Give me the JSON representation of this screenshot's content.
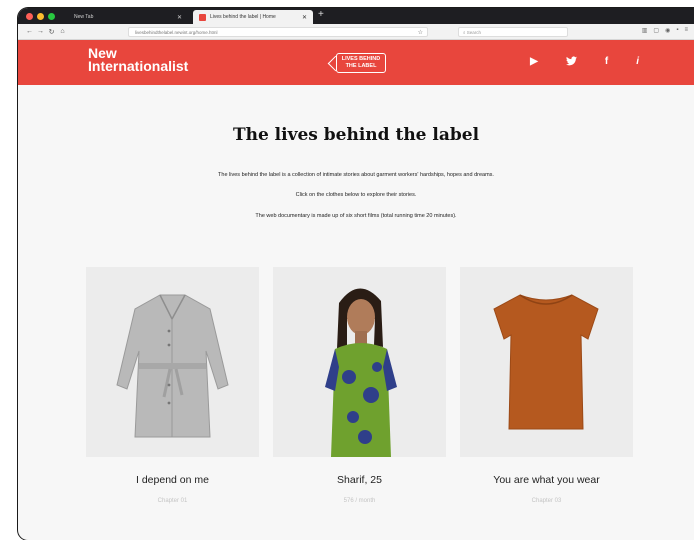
{
  "browser": {
    "tabs": [
      {
        "label": "New Tab"
      },
      {
        "label": "Lives behind the label | Home"
      }
    ],
    "url": "livesbehindthelabel.newint.org/home.html",
    "search_placeholder": "Search"
  },
  "header": {
    "logo_line1": "New",
    "logo_line2": "Internationalist",
    "badge_line1": "LIVES BEHIND",
    "badge_line2": "THE LABEL",
    "icons": [
      "play-icon",
      "twitter-icon",
      "facebook-icon",
      "info-icon"
    ],
    "icon_glyphs": [
      "▶",
      "🐦",
      "f",
      "i"
    ],
    "colors": {
      "brand": "#e8463d"
    }
  },
  "main": {
    "title": "The lives behind the label",
    "desc1": "The lives behind the label is a collection of intimate stories about garment workers' hardships, hopes and dreams.",
    "desc2": "Click on the clothes below to explore their stories.",
    "desc3": "The web documentary is made up of six short films (total running time 20 minutes).",
    "cards": [
      {
        "title": "I depend on me",
        "subtitle": "Chapter 01"
      },
      {
        "title": "Sharif, 25",
        "subtitle": "576 / month"
      },
      {
        "title": "You are what you wear",
        "subtitle": "Chapter 03"
      }
    ]
  }
}
